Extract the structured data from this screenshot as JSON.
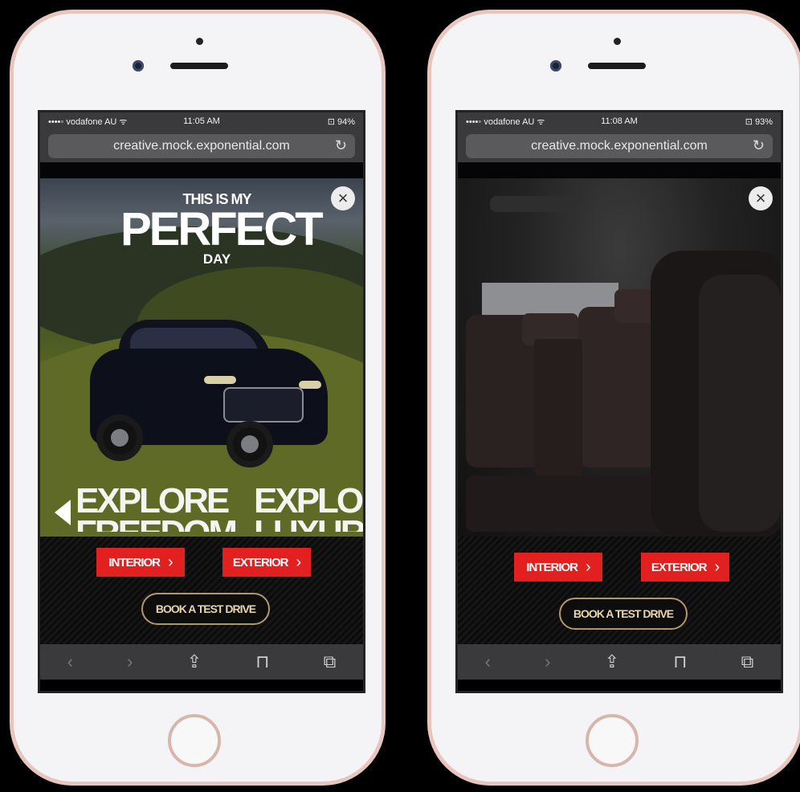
{
  "phones": [
    {
      "status": {
        "carrier": "••••◦ vodafone AU ᯤ",
        "time": "11:05 AM",
        "battery": "⊡ 94%"
      },
      "url": "creative.mock.exponential.com",
      "headline": {
        "line1": "THIS IS MY",
        "line2": "PERFECT",
        "line3": "DAY"
      },
      "explore_left": {
        "line1": "EXPLORE",
        "line2": "FREEDOM"
      },
      "explore_right": {
        "line1": "EXPLORE",
        "line2": "LUXURY"
      },
      "buttons": {
        "interior": "INTERIOR",
        "exterior": "EXTERIOR",
        "book": "BOOK A TEST DRIVE"
      },
      "close_label": "×"
    },
    {
      "status": {
        "carrier": "••••◦ vodafone AU ᯤ",
        "time": "11:08 AM",
        "battery": "⊡ 93%"
      },
      "url": "creative.mock.exponential.com",
      "buttons": {
        "interior": "INTERIOR",
        "exterior": "EXTERIOR",
        "book": "BOOK A TEST DRIVE"
      },
      "close_label": "×"
    }
  ],
  "toolbar_icons": [
    "back-icon",
    "forward-icon",
    "share-icon",
    "bookmarks-icon",
    "tabs-icon"
  ],
  "colors": {
    "cta_red": "#e1201f",
    "book_border": "#b3976c",
    "phone_frame": "#e8c6bd"
  }
}
